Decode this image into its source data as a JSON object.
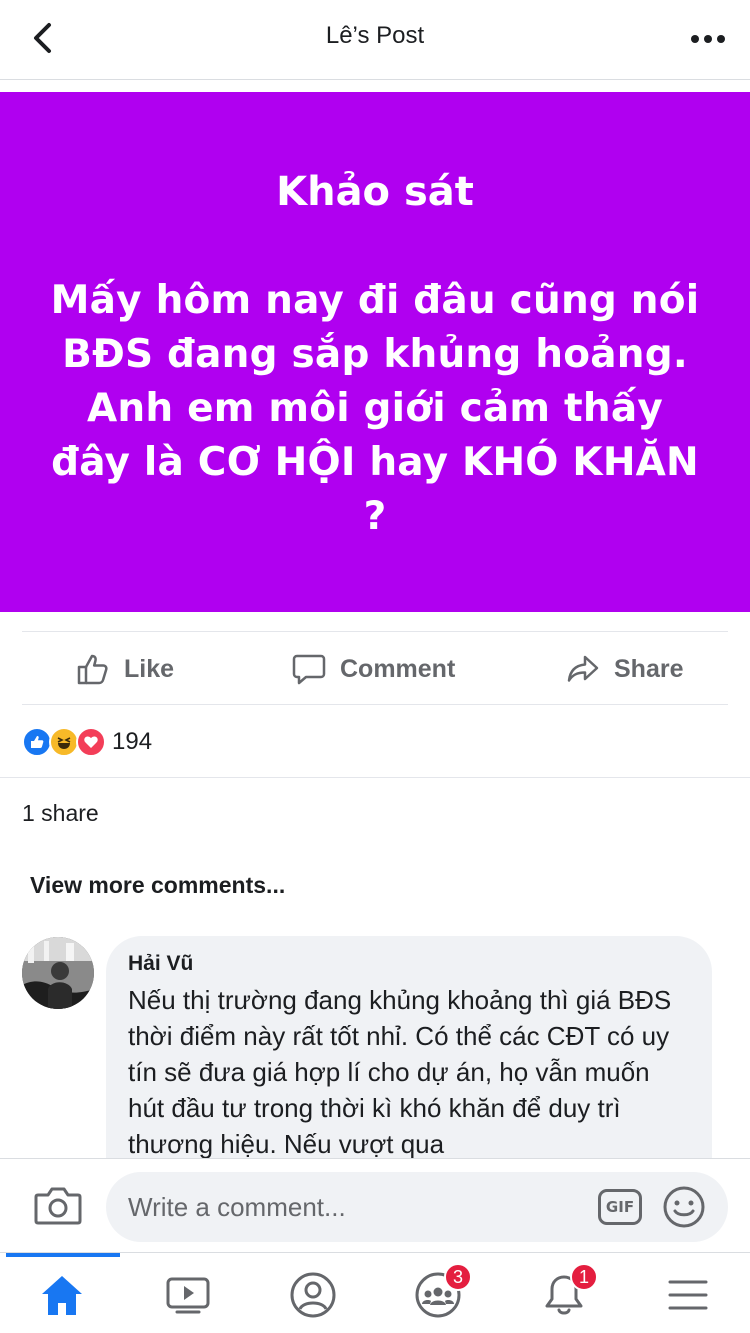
{
  "header": {
    "title": "Lê’s Post",
    "back_icon": "chevron-left-icon",
    "more_icon": "more-horizontal-icon"
  },
  "post": {
    "background_color": "#b000f0",
    "title": "Khảo sát",
    "body": "Mấy hôm nay đi đâu cũng nói BĐS đang sắp khủng hoảng. Anh em môi giới cảm thấy đây là CƠ HỘI hay KHÓ KHĂN ?"
  },
  "actions": {
    "like_label": "Like",
    "comment_label": "Comment",
    "share_label": "Share"
  },
  "reactions": {
    "icons": [
      "like-reaction-icon",
      "haha-reaction-icon",
      "love-reaction-icon"
    ],
    "count": "194"
  },
  "shares": {
    "label": "1 share"
  },
  "comments": {
    "view_more_label": "View more comments...",
    "items": [
      {
        "author": "Hải Vũ",
        "text": "Nếu thị trường đang khủng khoảng thì giá BĐS thời điểm này rất tốt nhỉ. Có thể các CĐT có uy tín sẽ đưa giá hợp lí cho dự án, họ vẫn muốn hút đầu tư trong thời kì khó khăn để duy trì thương hiệu. Nếu vượt qua"
      }
    ]
  },
  "composer": {
    "placeholder": "Write a comment...",
    "gif_label": "GIF"
  },
  "nav": {
    "items": [
      {
        "name": "home",
        "icon": "home-icon",
        "active": true
      },
      {
        "name": "watch",
        "icon": "video-icon"
      },
      {
        "name": "profile",
        "icon": "profile-icon"
      },
      {
        "name": "groups",
        "icon": "groups-icon",
        "badge": "3"
      },
      {
        "name": "notifications",
        "icon": "bell-icon",
        "badge": "1"
      },
      {
        "name": "menu",
        "icon": "menu-icon"
      }
    ],
    "accent_color": "#1877f2",
    "badge_color": "#e41e3f"
  }
}
